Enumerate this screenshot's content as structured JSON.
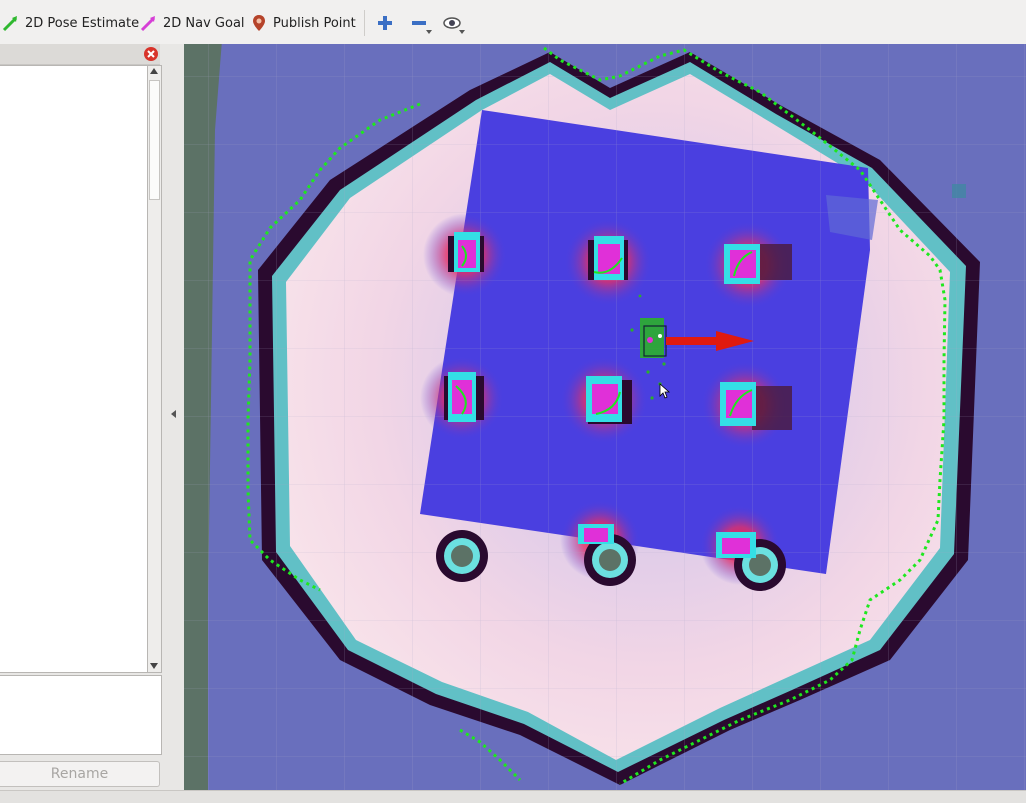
{
  "toolbar": {
    "tools": [
      {
        "label": "2D Pose Estimate",
        "icon": "green-arrow-icon",
        "color": "#2fb82f"
      },
      {
        "label": "2D Nav Goal",
        "icon": "magenta-arrow-icon",
        "color": "#d63fd6"
      },
      {
        "label": "Publish Point",
        "icon": "map-pin-icon",
        "color": "#c0392b"
      }
    ],
    "view_buttons": [
      {
        "name": "zoom-in",
        "icon": "plus-icon"
      },
      {
        "name": "zoom-out",
        "icon": "minus-icon"
      },
      {
        "name": "view-options",
        "icon": "eye-icon"
      }
    ]
  },
  "left_panel": {
    "close_icon": "close-icon",
    "rename_label": "Rename"
  },
  "map": {
    "colors": {
      "unknown": "#5c7266",
      "costmap_far": "#6a6fc4",
      "free": "#f4dbe3",
      "local_costmap": "#4a3fe0",
      "obstacle_core": "#2a0a2f",
      "obstacle_cyan": "#34dfe6",
      "inflation": "#ff2a5a",
      "path": "#1ee81e",
      "robot_heading": "#e01a10"
    }
  }
}
